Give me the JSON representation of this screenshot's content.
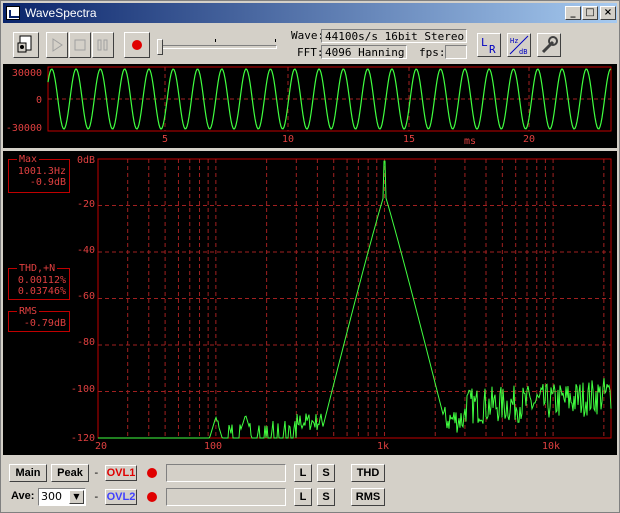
{
  "window": {
    "title": "WaveSpectra",
    "minimize": "_",
    "maximize": "□",
    "close": "×"
  },
  "toolbar": {
    "wave_label": "Wave:",
    "wave_value": "44100s/s 16bit Stereo",
    "fft_label": "FFT:",
    "fft_value": "4096 Hanning",
    "fps_label": "fps:",
    "fps_value": "",
    "lr_label": "LR",
    "hz_label": "Hz/dB"
  },
  "wave_panel": {
    "y_ticks": [
      "30000",
      "0",
      "-30000"
    ],
    "x_ticks": [
      "5",
      "10",
      "15",
      "20"
    ],
    "x_unit": "ms"
  },
  "spectrum_panel": {
    "y_ticks": [
      "0dB",
      "-20",
      "-40",
      "-60",
      "-80",
      "-100",
      "-120"
    ],
    "x_ticks": [
      "20",
      "100",
      "1k",
      "10k"
    ]
  },
  "readouts": {
    "max_label": "Max",
    "max_freq": "1001.3Hz",
    "max_level": "-0.9dB",
    "thd_label": "THD,+N",
    "thd_value": "0.00112%",
    "thdn_value": "0.03746%",
    "rms_label": "RMS",
    "rms_value": "-0.79dB"
  },
  "bottom": {
    "main_label": "Main",
    "peak_label": "Peak",
    "ave_label": "Ave:",
    "ave_value": "300",
    "ovl1_label": "OVL1",
    "ovl2_label": "OVL2",
    "dash": "-",
    "l_label": "L",
    "s_label": "S",
    "thd_button": "THD",
    "rms_button": "RMS"
  },
  "colors": {
    "trace": "#40ff40",
    "grid": "#a02020",
    "text_red": "#e04040",
    "ovl1": "#e00000",
    "ovl2": "#4040ff"
  }
}
